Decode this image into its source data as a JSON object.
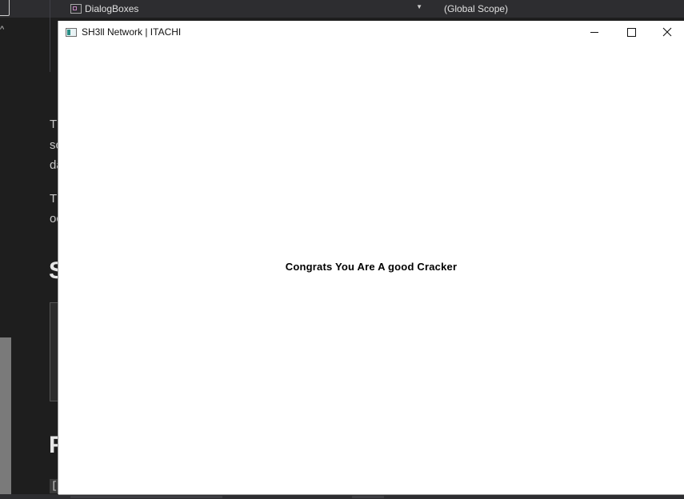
{
  "ide": {
    "nav_combo": "DialogBoxes",
    "scope_combo": "(Global Scope)",
    "text_fragments": [
      "Tl",
      "sc",
      "da",
      "Tl",
      "oc"
    ],
    "heading_fragments": [
      "S",
      "F"
    ],
    "bracket": "["
  },
  "dialog": {
    "title": "SH3ll Network | ITACHI",
    "message": "Congrats You Are A good Cracker",
    "icons": {
      "app": "app-window-icon",
      "minimize": "minimize-icon",
      "maximize": "maximize-icon",
      "close": "close-icon"
    }
  }
}
